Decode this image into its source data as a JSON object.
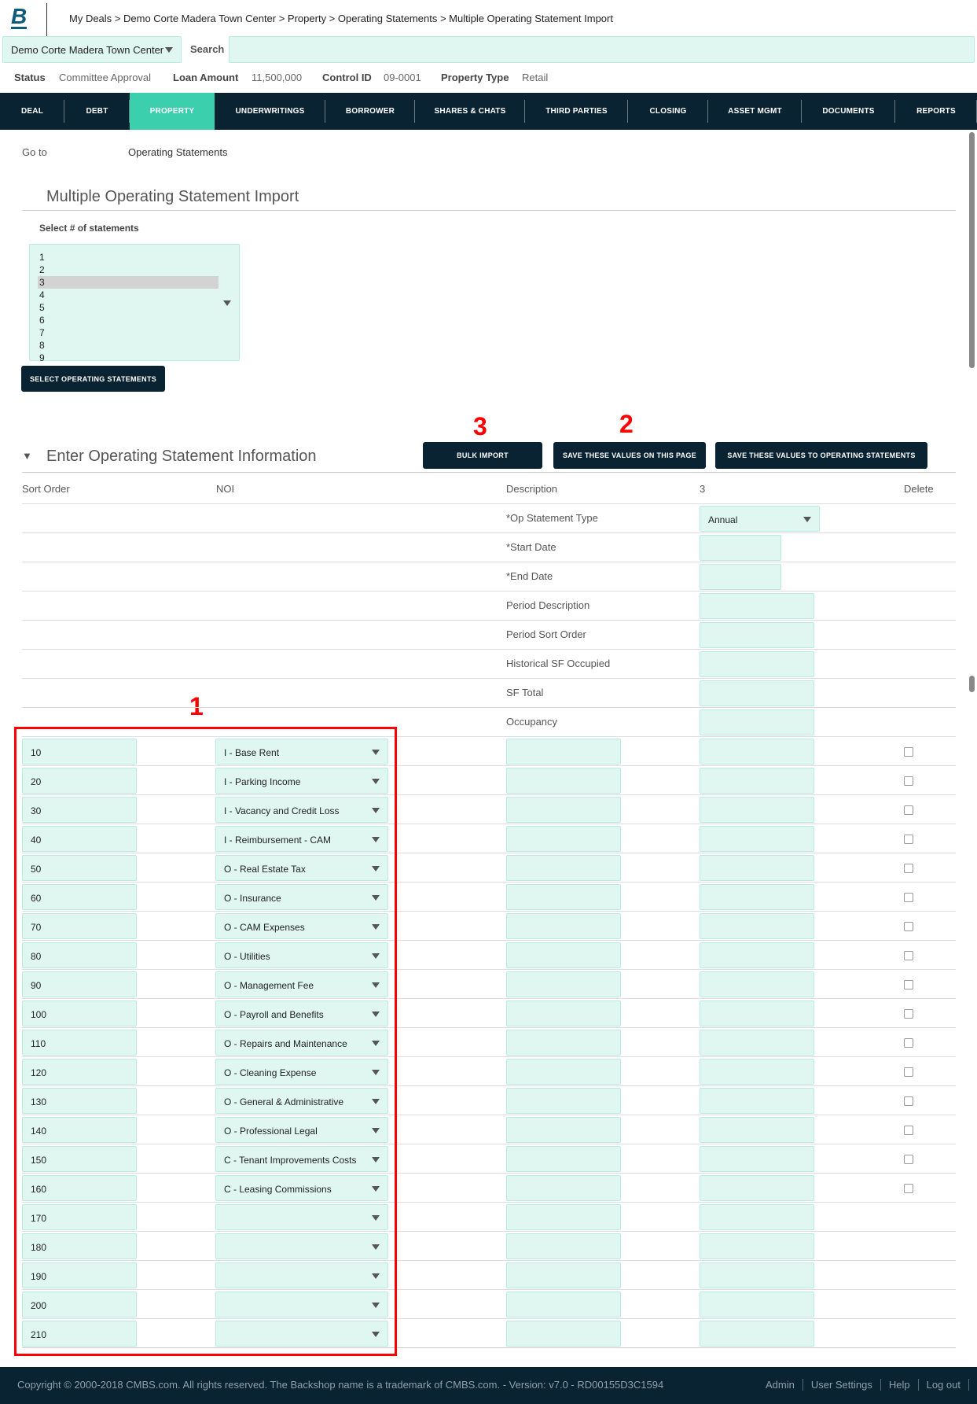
{
  "header": {
    "logo": "B",
    "breadcrumb": "My Deals > Demo Corte Madera Town Center > Property > Operating Statements > Multiple Operating Statement Import",
    "deal_select": "Demo Corte Madera Town Center",
    "search_label": "Search",
    "search_value": ""
  },
  "status": [
    {
      "label": "Status",
      "value": "Committee Approval"
    },
    {
      "label": "Loan Amount",
      "value": "11,500,000"
    },
    {
      "label": "Control ID",
      "value": "09-0001"
    },
    {
      "label": "Property Type",
      "value": "Retail"
    }
  ],
  "nav": {
    "tabs": [
      "DEAL",
      "DEBT",
      "PROPERTY",
      "UNDERWRITINGS",
      "BORROWER",
      "SHARES & CHATS",
      "THIRD PARTIES",
      "CLOSING",
      "ASSET MGMT",
      "DOCUMENTS",
      "REPORTS"
    ],
    "active": "PROPERTY"
  },
  "goto": {
    "label": "Go to",
    "value": "Operating Statements"
  },
  "import": {
    "title": "Multiple Operating Statement Import",
    "select_label": "Select # of statements",
    "options": [
      "1",
      "2",
      "3",
      "4",
      "5",
      "6",
      "7",
      "8",
      "9"
    ],
    "selected": "3",
    "select_button": "SELECT OPERATING STATEMENTS"
  },
  "section": {
    "title": "Enter Operating Statement Information",
    "buttons": {
      "bulk": "BULK IMPORT",
      "save_page": "SAVE THESE VALUES ON THIS PAGE",
      "save_os": "SAVE THESE VALUES TO OPERATING STATEMENTS"
    },
    "columns": {
      "sort": "Sort Order",
      "noi": "NOI",
      "desc": "Description",
      "stmt": "3",
      "delete": "Delete"
    },
    "meta_rows": [
      {
        "label": "*Op Statement Type",
        "value": "Annual",
        "type": "select"
      },
      {
        "label": "*Start Date",
        "type": "date"
      },
      {
        "label": "*End Date",
        "type": "date"
      },
      {
        "label": "Period Description"
      },
      {
        "label": "Period Sort Order"
      },
      {
        "label": "Historical SF Occupied"
      },
      {
        "label": "SF Total"
      },
      {
        "label": "Occupancy"
      }
    ],
    "data_rows": [
      {
        "sort": "10",
        "noi": "I - Base Rent",
        "delete": true
      },
      {
        "sort": "20",
        "noi": "I - Parking Income",
        "delete": true
      },
      {
        "sort": "30",
        "noi": "I - Vacancy and Credit Loss",
        "delete": true
      },
      {
        "sort": "40",
        "noi": "I - Reimbursement - CAM",
        "delete": true
      },
      {
        "sort": "50",
        "noi": "O - Real Estate Tax",
        "delete": true
      },
      {
        "sort": "60",
        "noi": "O - Insurance",
        "delete": true
      },
      {
        "sort": "70",
        "noi": "O - CAM Expenses",
        "delete": true
      },
      {
        "sort": "80",
        "noi": "O - Utilities",
        "delete": true
      },
      {
        "sort": "90",
        "noi": "O - Management Fee",
        "delete": true
      },
      {
        "sort": "100",
        "noi": "O - Payroll and Benefits",
        "delete": true
      },
      {
        "sort": "110",
        "noi": "O - Repairs and Maintenance",
        "delete": true
      },
      {
        "sort": "120",
        "noi": "O - Cleaning Expense",
        "delete": true
      },
      {
        "sort": "130",
        "noi": "O - General & Administrative",
        "delete": true
      },
      {
        "sort": "140",
        "noi": "O - Professional Legal",
        "delete": true
      },
      {
        "sort": "150",
        "noi": "C - Tenant Improvements Costs",
        "delete": true
      },
      {
        "sort": "160",
        "noi": "C - Leasing Commissions",
        "delete": true
      },
      {
        "sort": "170",
        "noi": "",
        "delete": false
      },
      {
        "sort": "180",
        "noi": "",
        "delete": false
      },
      {
        "sort": "190",
        "noi": "",
        "delete": false
      },
      {
        "sort": "200",
        "noi": "",
        "delete": false
      },
      {
        "sort": "210",
        "noi": "",
        "delete": false
      }
    ]
  },
  "annotations": [
    "1",
    "2",
    "3"
  ],
  "footer": {
    "copyright": "Copyright © 2000-2018 CMBS.com. All rights reserved. The Backshop name is a trademark of CMBS.com. - Version: v7.0 - RD00155D3C1594",
    "links": [
      "Admin",
      "User Settings",
      "Help",
      "Log out"
    ]
  },
  "colors": {
    "navy": "#0a2332",
    "accent": "#3ccfae",
    "input_bg": "#e0f7f1",
    "annotation": "#ff0000"
  }
}
